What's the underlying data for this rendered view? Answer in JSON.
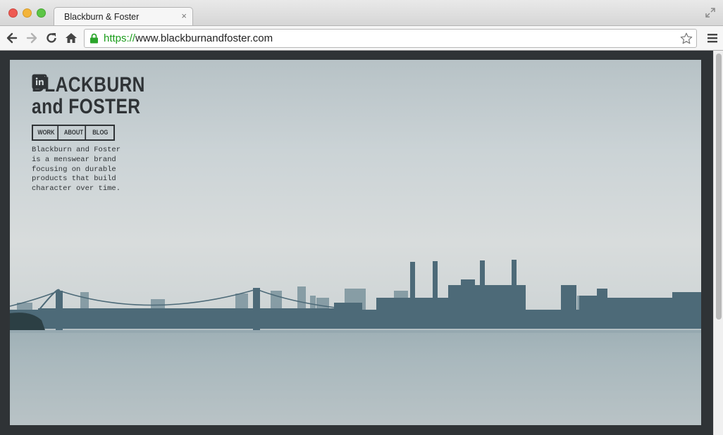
{
  "window": {
    "tab_title": "Blackburn & Foster",
    "tab_close": "×"
  },
  "omnibox": {
    "url_scheme": "https",
    "url_separator": "://",
    "url_host": "www.blackburnandfoster.com"
  },
  "icons": {
    "back": "back-arrow-icon",
    "forward": "forward-arrow-icon",
    "reload": "reload-icon",
    "home": "home-icon",
    "lock": "lock-icon",
    "star": "star-icon",
    "menu": "hamburger-menu-icon",
    "fullscreen": "fullscreen-icon"
  },
  "site": {
    "logo_line1": "BLACKBURN",
    "logo_line2": "and FOSTER",
    "nav": [
      "WORK",
      "ABOUT",
      "BLOG"
    ],
    "tagline": "Blackburn and Foster is a menswear brand focusing on durable products that build character over time.",
    "social": [
      "facebook-icon",
      "instagram-icon",
      "twitter-icon",
      "linkedin-icon"
    ]
  },
  "colors": {
    "ink": "#2f3336",
    "url_green": "#1a9c1a",
    "frame": "#2f3336"
  }
}
